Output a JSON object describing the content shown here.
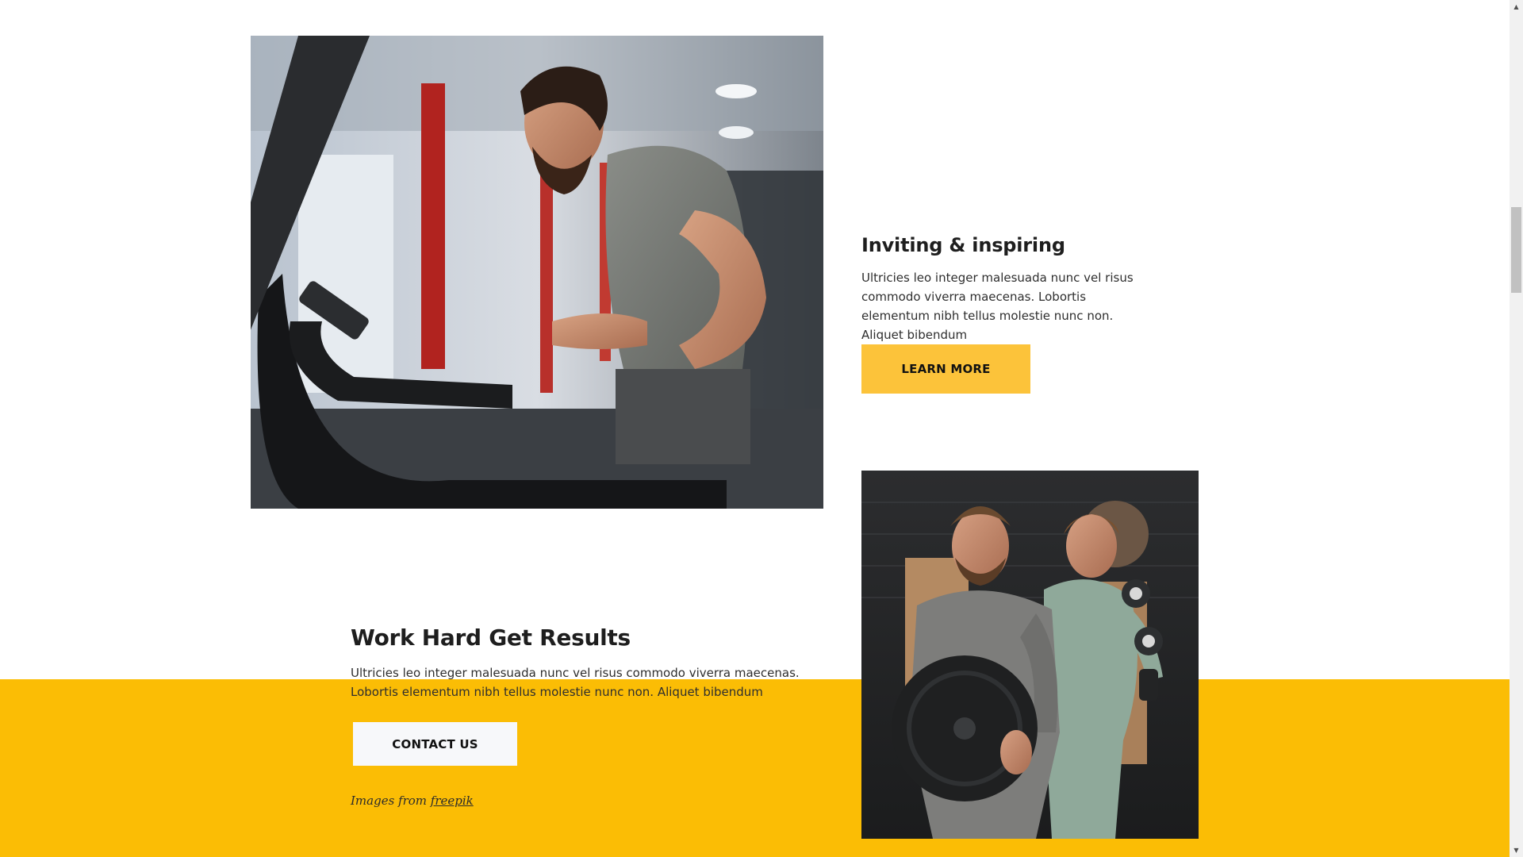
{
  "inviting_section": {
    "title": "Inviting & inspiring",
    "body": "Ultricies leo integer malesuada nunc vel risus commodo viverra maecenas. Lobortis elementum nibh tellus molestie nunc non. Aliquet bibendum",
    "button_label": "LEARN MORE"
  },
  "work_section": {
    "title": "Work Hard Get Results",
    "body": "Ultricies leo integer malesuada nunc vel risus commodo viverra maecenas. Lobortis elementum nibh tellus molestie nunc non. Aliquet bibendum",
    "button_label": "CONTACT US"
  },
  "credits": {
    "prefix": "Images from",
    "link_text": "freepik"
  },
  "colors": {
    "accent_yellow": "#fbbd05",
    "button_yellow": "#fcc33a",
    "button_light": "#f7f8fa",
    "text_dark": "#1e1e1e"
  },
  "images": {
    "treadmill": "photo-man-running-on-treadmill",
    "couple": "photo-man-with-weight-plate-and-woman-with-dumbbells"
  },
  "scrollbar": {
    "up_arrow": "▲",
    "down_arrow": "▼"
  }
}
